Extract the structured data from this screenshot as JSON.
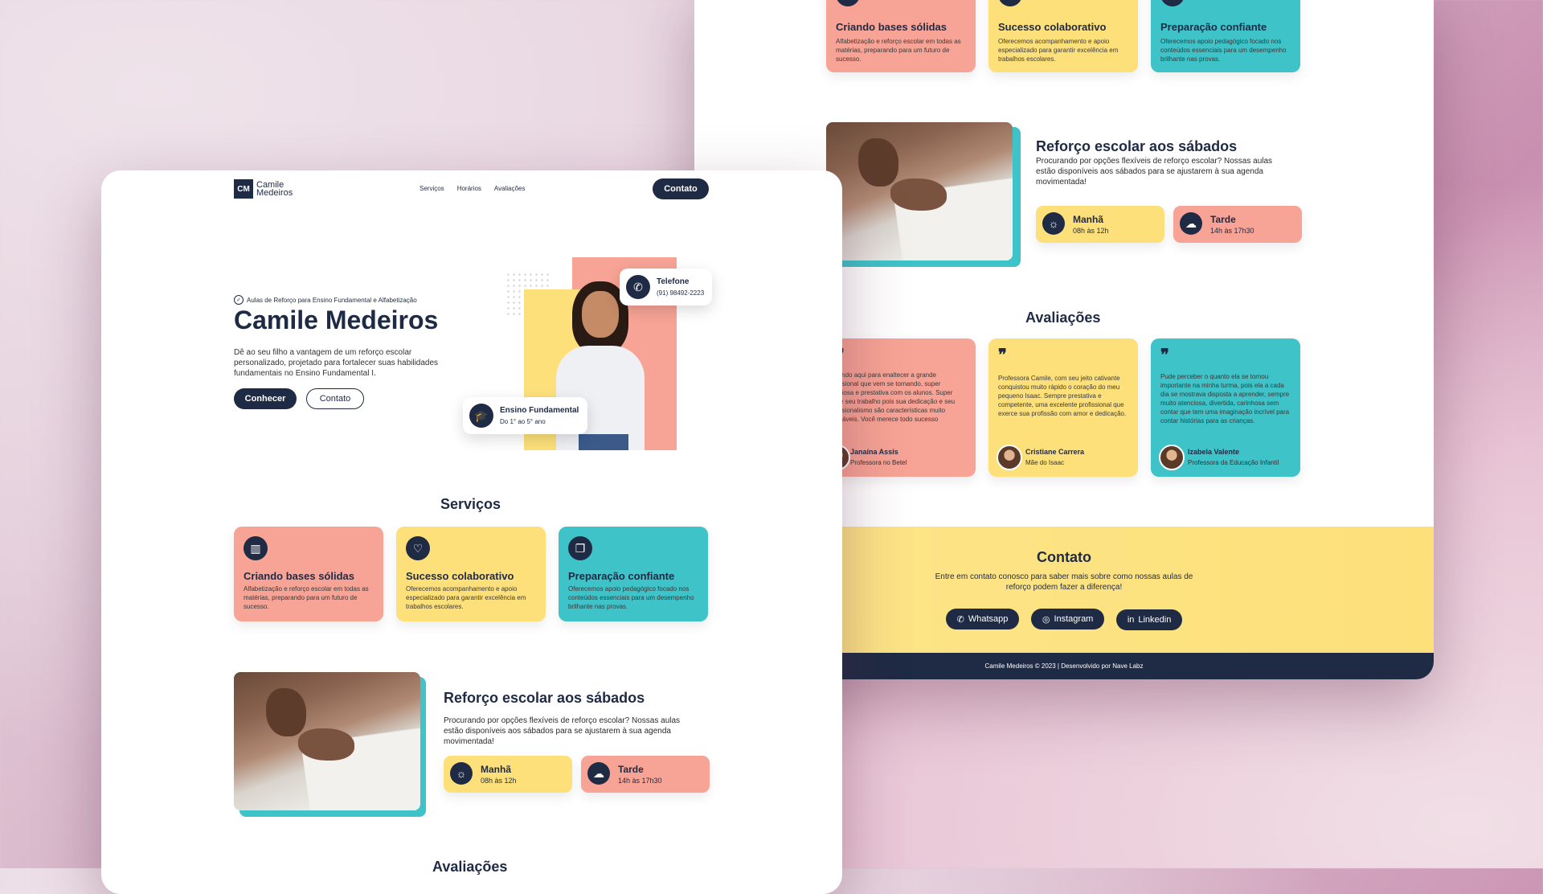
{
  "brand": {
    "name_line1": "Camile",
    "name_line2": "Medeiros",
    "mono": "CM"
  },
  "nav": {
    "items": [
      "Serviços",
      "Horários",
      "Avaliações"
    ],
    "contact_button": "Contato"
  },
  "hero": {
    "tagline": "Aulas de Reforço para Ensino Fundamental e Alfabetização",
    "title": "Camile Medeiros",
    "description": "Dê ao seu filho a vantagem de um reforço escolar personalizado, projetado para fortalecer suas habilidades fundamentais no Ensino Fundamental I.",
    "btn_primary": "Conhecer",
    "btn_secondary": "Contato",
    "phone_card": {
      "label": "Telefone",
      "value": "(91) 98492-2223"
    },
    "level_card": {
      "label": "Ensino Fundamental",
      "value": "Do 1° ao 5° ano"
    }
  },
  "services": {
    "title": "Serviços",
    "items": [
      {
        "title": "Criando bases sólidas",
        "text": "Alfabetização e reforço escolar em todas as matérias, preparando para um futuro de sucesso.",
        "icon": "books-icon",
        "color": "#f7a395"
      },
      {
        "title": "Sucesso colaborativo",
        "text": "Oferecemos acompanhamento e apoio especializado para garantir excelência em trabalhos escolares.",
        "icon": "heart-handshake-icon",
        "color": "#fde07a"
      },
      {
        "title": "Preparação confiante",
        "text": "Oferecemos apoio pedagógico focado nos conteúdos essenciais para um desempenho brilhante nas provas.",
        "icon": "copy-icon",
        "color": "#3ec3c8"
      }
    ]
  },
  "saturday": {
    "title": "Reforço escolar aos sábados",
    "text": "Procurando por opções flexíveis de reforço escolar? Nossas aulas estão disponíveis aos sábados para se ajustarem à sua agenda movimentada!",
    "slots": [
      {
        "label": "Manhã",
        "time": "08h às 12h",
        "icon": "sun-icon",
        "color": "#fde07a"
      },
      {
        "label": "Tarde",
        "time": "14h às 17h30",
        "icon": "sun-cloud-icon",
        "color": "#f7a395"
      }
    ]
  },
  "reviews": {
    "title": "Avaliações",
    "items": [
      {
        "text": "...ssando aqui para enaltecer a grande profissional que vem se tornando, super atenciosa e prestativa com os alunos. Super índice seu trabalho pois sua dedicação e seu profissionalismo são características muito admiráveis. Você merece todo sucesso",
        "name": "Janaína Assis",
        "role": "Professora no Betel",
        "color": "#f7a395"
      },
      {
        "text": "Professora Camile, com seu jeito cativante conquistou muito rápido o coração do meu pequeno Isaac. Sempre prestativa e competente, uma excelente profissional que exerce sua profissão com amor e dedicação.",
        "name": "Cristiane Carrera",
        "role": "Mãe do Isaac",
        "color": "#fde07a"
      },
      {
        "text": "Pude perceber o quanto ela se tornou importante na minha turma, pois ela a cada dia se mostrava disposta a aprender, sempre muito atenciosa, divertida, carinhosa sem contar que tem uma imaginação incrível para contar histórias para as crianças.",
        "name": "Izabela Valente",
        "role": "Professora da Educação Infantil",
        "color": "#3ec3c8"
      }
    ]
  },
  "contact": {
    "title": "Contato",
    "text": "Entre em contato conosco para saber mais sobre como nossas aulas de reforço podem fazer a diferença!",
    "buttons": [
      {
        "label": "Whatsapp",
        "icon": "whatsapp-icon"
      },
      {
        "label": "Instagram",
        "icon": "instagram-icon"
      },
      {
        "label": "Linkedin",
        "icon": "linkedin-icon"
      }
    ]
  },
  "footer": {
    "text": "Camile Medeiros © 2023 | Desenvolvido por Nave Labz"
  },
  "colors": {
    "navy": "#1f2a44",
    "salmon": "#f7a395",
    "yellow": "#fde07a",
    "teal": "#3ec3c8"
  }
}
